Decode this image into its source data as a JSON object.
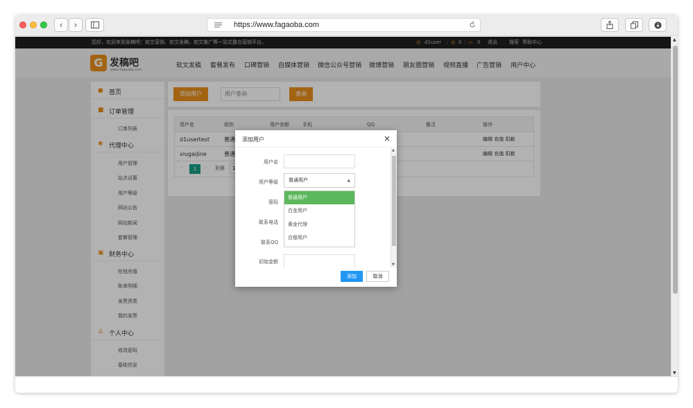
{
  "browser": {
    "url": "https://www.fagaoba.com",
    "back_glyph": "‹",
    "forward_glyph": "›"
  },
  "topbar": {
    "welcome": "您好，欢迎来到发稿吧：软文营销、软文发稿、软文推广等一站式整合营销平台。",
    "username": "d1user",
    "coins": "0",
    "messages": "0",
    "logout": "退出",
    "search": "搜索",
    "help": "帮助中心"
  },
  "header": {
    "logo_mark": "G",
    "logo_text": "发稿吧",
    "logo_sub": "www.fagaoba.com",
    "nav": [
      "软文发稿",
      "套餐发布",
      "口碑营销",
      "自媒体营销",
      "微信公众号营销",
      "微博营销",
      "朋友圈营销",
      "视频直播",
      "广告营销",
      "用户中心"
    ]
  },
  "sidebar": {
    "home": "首页",
    "orders": {
      "title": "订单管理",
      "items": [
        "订单列表"
      ]
    },
    "agent": {
      "title": "代理中心",
      "items": [
        "用户管理",
        "站点设置",
        "用户等级",
        "网站公告",
        "网站新闻",
        "套餐管理"
      ]
    },
    "finance": {
      "title": "财务中心",
      "items": [
        "在线充值",
        "账单明细",
        "发票资质",
        "我的发票"
      ]
    },
    "personal": {
      "title": "个人中心",
      "items": [
        "修改密码",
        "基础信息"
      ]
    }
  },
  "toolbar": {
    "add_user": "添加用户",
    "search_placeholder": "用户查询",
    "query": "查询"
  },
  "table": {
    "headers": [
      "用户名",
      "级别",
      "用户余额",
      "手机",
      "QQ",
      "备注",
      "操作"
    ],
    "rows": [
      {
        "username": "d1usertest",
        "level": "普通",
        "ops": "编辑 充值 扣款"
      },
      {
        "username": "xiugaijine",
        "level": "普通",
        "ops": "编辑 充值 扣款"
      }
    ],
    "pager": {
      "current": "1",
      "goto": "到第"
    }
  },
  "dialog": {
    "title": "添加用户",
    "close": "×",
    "fields": {
      "username": "用户名",
      "level": "用户等级",
      "password": "密码",
      "phone": "联系电话",
      "qq": "联系QQ",
      "initial_amount": "初始金额"
    },
    "level_selected": "普通用户",
    "level_options": [
      "普通用户",
      "白金用户",
      "黄金代理",
      "白银用户"
    ],
    "add": "添加",
    "cancel": "取消"
  },
  "colors": {
    "accent": "#e8901c",
    "selected_option": "#5cb85c",
    "primary_button": "#2196f3"
  }
}
